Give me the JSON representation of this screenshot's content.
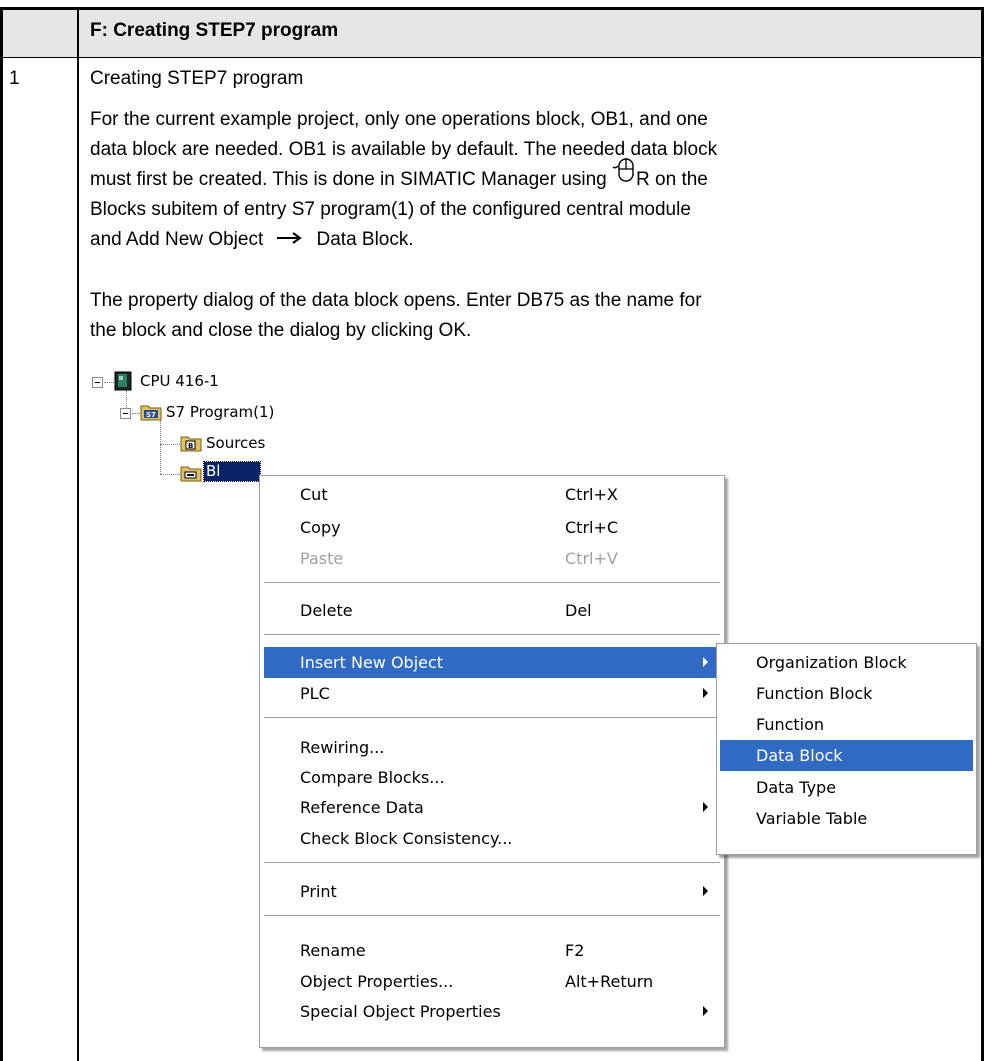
{
  "header": {
    "title": "F: Creating STEP7 program"
  },
  "step": {
    "number": "1",
    "title": "Creating STEP7 program",
    "paragraph1": {
      "line1": "For the current example project, only one operations block, OB1, and one",
      "line2": "data block are needed. OB1 is available by default. The needed data block",
      "line3_before": "must first be created. This is done in SIMATIC Manager using ",
      "line3_after": "R on the",
      "line4": "Blocks subitem of entry S7 program(1) of the configured central module",
      "line5_before": "and Add New Object ",
      "line5_after": "Data Block."
    },
    "paragraph2": {
      "line1": "The property dialog of the data block opens. Enter DB75 as the name for",
      "line2": "the block and close the dialog by clicking OK."
    }
  },
  "tree": {
    "cpu": "CPU 416-1",
    "program": "S7 Program(1)",
    "sources": "Sources",
    "blocks": "Bl"
  },
  "context_menu": {
    "cut": {
      "label": "Cut",
      "shortcut": "Ctrl+X"
    },
    "copy": {
      "label": "Copy",
      "shortcut": "Ctrl+C"
    },
    "paste": {
      "label": "Paste",
      "shortcut": "Ctrl+V"
    },
    "delete": {
      "label": "Delete",
      "shortcut": "Del"
    },
    "insert_new_object": {
      "label": "Insert New Object"
    },
    "plc": {
      "label": "PLC"
    },
    "rewiring": {
      "label": "Rewiring..."
    },
    "compare_blocks": {
      "label": "Compare Blocks..."
    },
    "reference_data": {
      "label": "Reference Data"
    },
    "check_consistency": {
      "label": "Check Block Consistency..."
    },
    "print": {
      "label": "Print"
    },
    "rename": {
      "label": "Rename",
      "shortcut": "F2"
    },
    "object_properties": {
      "label": "Object Properties...",
      "shortcut": "Alt+Return"
    },
    "special_object_properties": {
      "label": "Special Object Properties"
    }
  },
  "submenu": {
    "organization_block": "Organization Block",
    "function_block": "Function Block",
    "function": "Function",
    "data_block": "Data Block",
    "data_type": "Data Type",
    "variable_table": "Variable Table"
  },
  "colors": {
    "highlight": "#316ac5",
    "header_shade": "#e6e6e6",
    "disabled": "#a0a0a0"
  },
  "icons": [
    "mouse-right-click-icon",
    "arrow-right-icon",
    "cpu-icon",
    "s7-program-icon",
    "sources-folder-icon",
    "blocks-folder-icon",
    "submenu-arrow-icon"
  ]
}
